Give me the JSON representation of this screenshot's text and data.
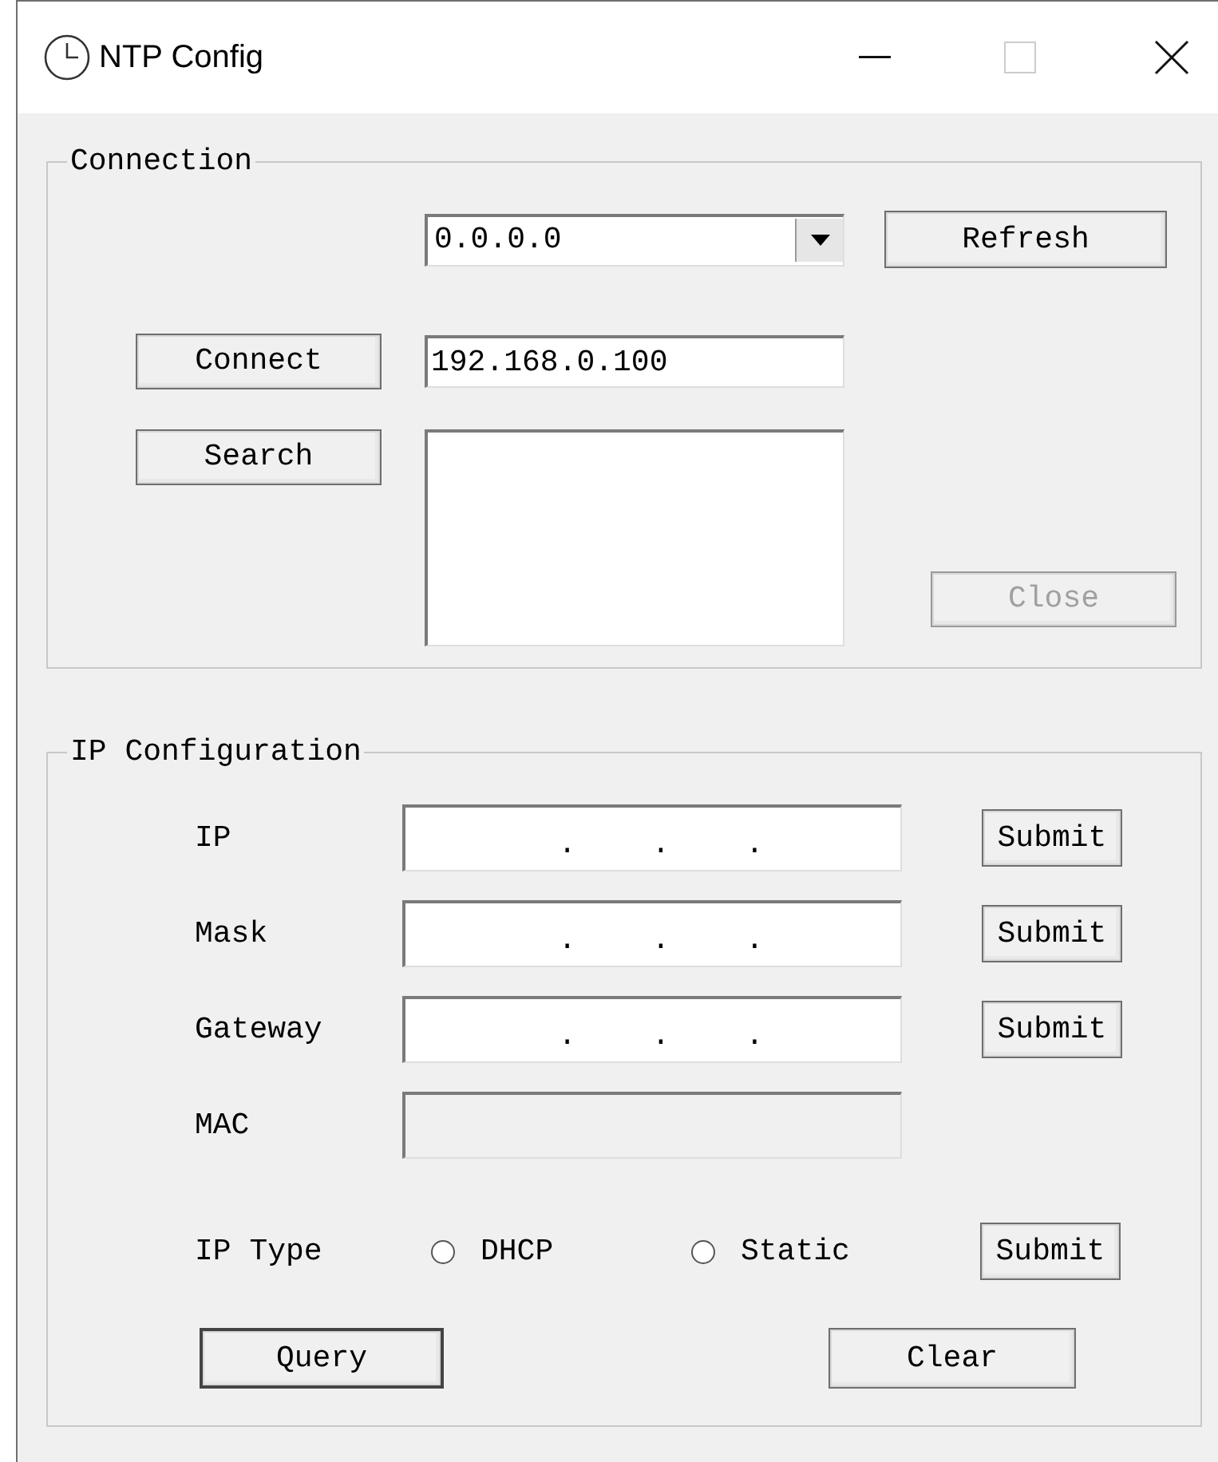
{
  "window": {
    "title": "NTP Config"
  },
  "connection": {
    "title": "Connection",
    "device_select": {
      "value": "0.0.0.0"
    },
    "refresh_button": {
      "label": "Refresh",
      "disabled": false
    },
    "connect_button": {
      "label": "Connect",
      "disabled": false
    },
    "address_field": {
      "value": "192.168.0.100"
    },
    "search_button": {
      "label": "Search",
      "disabled": false
    },
    "close_button": {
      "label": "Close",
      "disabled": true
    }
  },
  "ip_configuration": {
    "title": "IP Configuration",
    "fields": [
      {
        "label": "IP",
        "kind": "ip",
        "separators": [
          ".",
          ".",
          "."
        ],
        "submit": "Submit"
      },
      {
        "label": "Mask",
        "kind": "ip",
        "separators": [
          ".",
          ".",
          "."
        ],
        "submit": "Submit"
      },
      {
        "label": "Gateway",
        "kind": "ip",
        "separators": [
          ".",
          ".",
          "."
        ],
        "submit": "Submit"
      },
      {
        "label": "MAC",
        "kind": "plain",
        "disabled": true
      }
    ],
    "ip_type": {
      "label": "IP Type",
      "options": [
        {
          "label": "DHCP",
          "selected": false
        },
        {
          "label": "Static",
          "selected": false
        }
      ],
      "submit": "Submit"
    },
    "query_button": {
      "label": "Query",
      "default": true
    },
    "clear_button": {
      "label": "Clear",
      "default": false
    }
  }
}
